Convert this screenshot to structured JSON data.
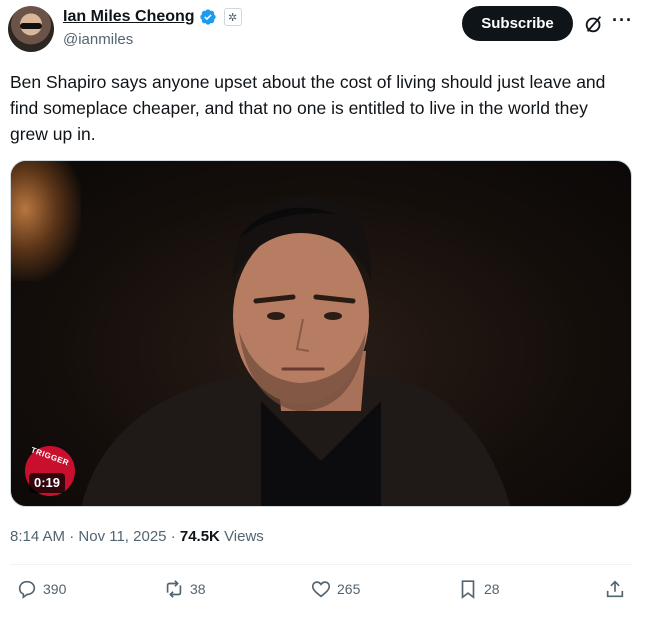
{
  "author": {
    "name": "Ian Miles Cheong",
    "handle": "@ianmiles",
    "verified": true,
    "verified_color": "#1d9bf0"
  },
  "header": {
    "subscribe_label": "Subscribe",
    "more_label": "···"
  },
  "post": {
    "text": "Ben Shapiro says anyone upset about the cost of living should just leave and find someplace cheaper, and that no one is entitled to live in the world they grew up in."
  },
  "media": {
    "badge_text": "TRIGGER",
    "duration": "0:19"
  },
  "meta": {
    "time": "8:14 AM",
    "sep1": "·",
    "date": "Nov 11, 2025",
    "sep2": "·",
    "views_count": "74.5K",
    "views_label": "Views"
  },
  "actions": {
    "replies": "390",
    "reposts": "38",
    "likes": "265",
    "bookmarks": "28"
  },
  "icons": {
    "verified": "verified-badge-icon",
    "affiliation": "affiliation-icon",
    "grok": "grok-icon",
    "reply": "reply-icon",
    "repost": "repost-icon",
    "like": "heart-icon",
    "bookmark": "bookmark-icon",
    "share": "share-icon"
  }
}
